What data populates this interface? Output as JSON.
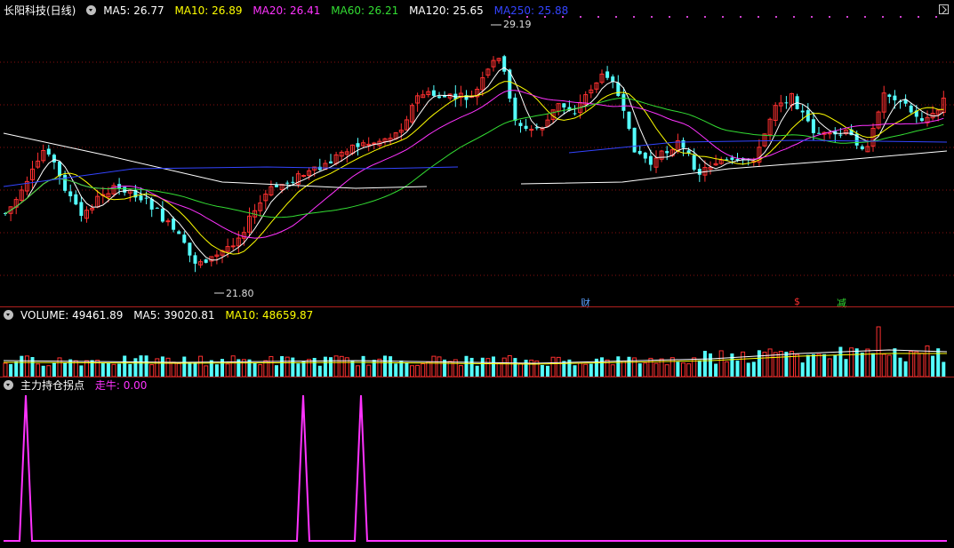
{
  "main": {
    "title": "长阳科技(日线)",
    "ma": [
      {
        "label": "MA5: 26.77",
        "color": "#ffffff"
      },
      {
        "label": "MA10: 26.89",
        "color": "#ffff00"
      },
      {
        "label": "MA20: 26.41",
        "color": "#ff33ff"
      },
      {
        "label": "MA60: 26.21",
        "color": "#33dd33"
      },
      {
        "label": "MA120: 25.65",
        "color": "#ffffff"
      },
      {
        "label": "MA250: 25.88",
        "color": "#3344ff"
      }
    ],
    "high_label": "29.19",
    "low_label": "21.80",
    "markers": [
      {
        "text": "财",
        "color": "#5aa0ff"
      },
      {
        "text": "$",
        "color": "#ff3030"
      },
      {
        "text": "减",
        "color": "#33dd33"
      }
    ]
  },
  "volume": {
    "label": "VOLUME: 49461.89",
    "ma5": "MA5: 39020.81",
    "ma10": "MA10: 48659.87"
  },
  "indicator": {
    "title": "主力持仓拐点",
    "field": "走牛: 0.00"
  },
  "colors": {
    "up": "#ff3030",
    "down": "#54ffff",
    "ma5": "#ffffff",
    "ma10": "#ffff00",
    "ma20": "#ff33ff",
    "ma60": "#33dd33",
    "ma120": "#ffffff",
    "ma250": "#3344ff",
    "indicator_line": "#ff33ff"
  }
}
